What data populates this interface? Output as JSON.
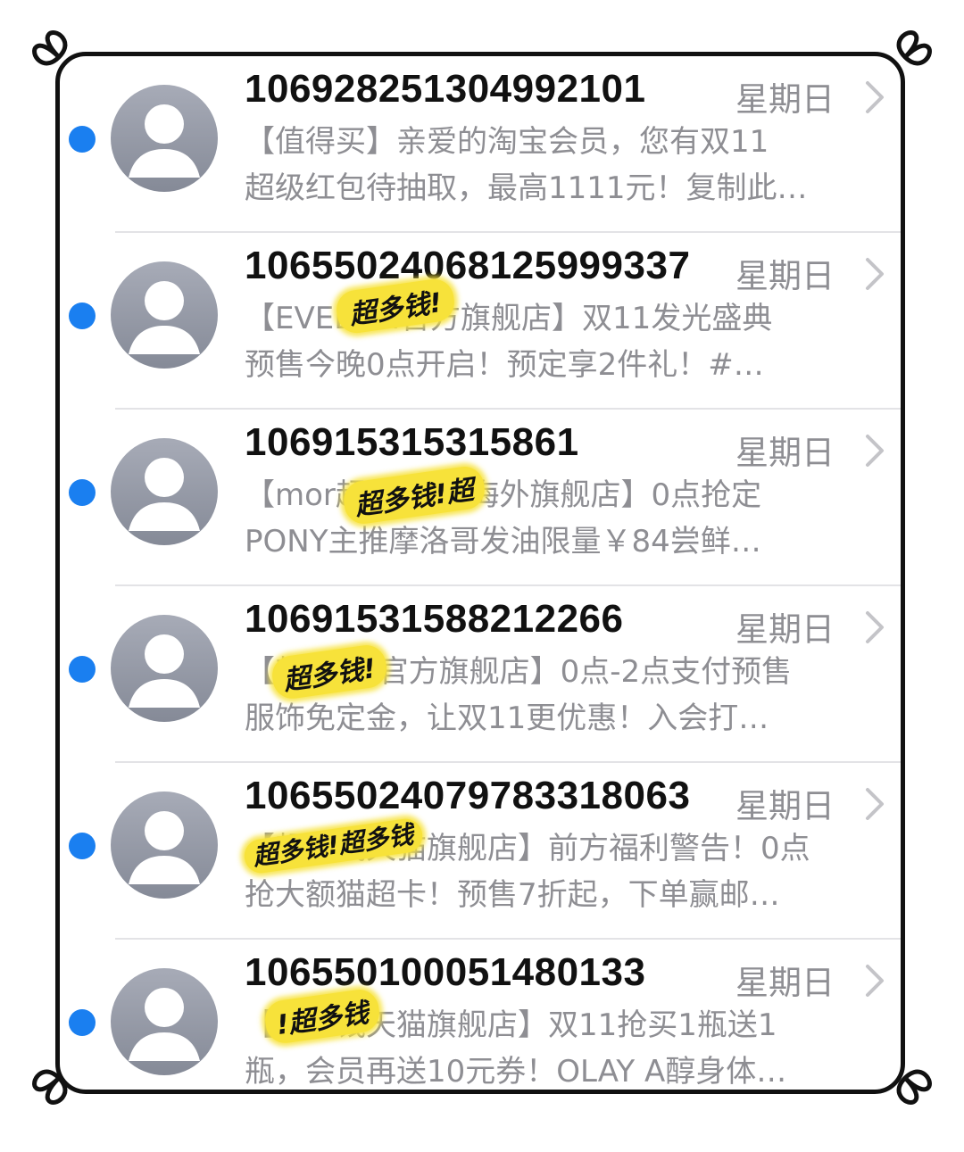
{
  "messages": [
    {
      "sender": "106928251304992101",
      "date": "星期日",
      "preview_line1": "【值得买】亲爱的淘宝会员，您有双11",
      "preview_line2": "超级红包待抽取，最高1111元！复制此…",
      "sticker": ""
    },
    {
      "sender": "10655024068125999337",
      "date": "星期日",
      "preview_line1": "【EVELOM官方旗舰店】双11发光盛典",
      "preview_line2": "预售今晚0点开启！预定享2件礼！#…",
      "sticker": "超多钱!"
    },
    {
      "sender": "106915315315861",
      "date": "星期日",
      "preview_line1": "【mor超多钱!超海外旗舰店】0点抢定",
      "preview_line2": "PONY主推摩洛哥发油限量￥84尝鲜…",
      "sticker": "超多钱!超"
    },
    {
      "sender": "10691531588212266",
      "date": "星期日",
      "preview_line1": "【超多钱!官方旗舰店】0点-2点支付预售",
      "preview_line2": "服饰免定金，让双11更优惠！入会打…",
      "sticker": "超多钱!"
    },
    {
      "sender": "10655024079783318063",
      "date": "星期日",
      "preview_line1": "【超多钱天猫旗舰店】前方福利警告！0点",
      "preview_line2": "抢大额猫超卡！预售7折起，下单赢邮…",
      "sticker": "超多钱!超多钱"
    },
    {
      "sender": "106550100051480133",
      "date": "星期日",
      "preview_line1": "【超多钱天猫旗舰店】双11抢买1瓶送1",
      "preview_line2": "瓶，会员再送10元券！OLAY A醇身体…",
      "sticker": "!超多钱"
    }
  ],
  "colors": {
    "unread_dot": "#1a7ff0",
    "sender_text": "#111111",
    "secondary_text": "#8e8e93",
    "separator": "#e3e3e6",
    "avatar": "#9a9eaa",
    "highlight": "#f7e23a"
  },
  "icons": {
    "avatar": "person-placeholder-icon",
    "chevron": "chevron-right-icon",
    "unread": "unread-dot-icon"
  }
}
